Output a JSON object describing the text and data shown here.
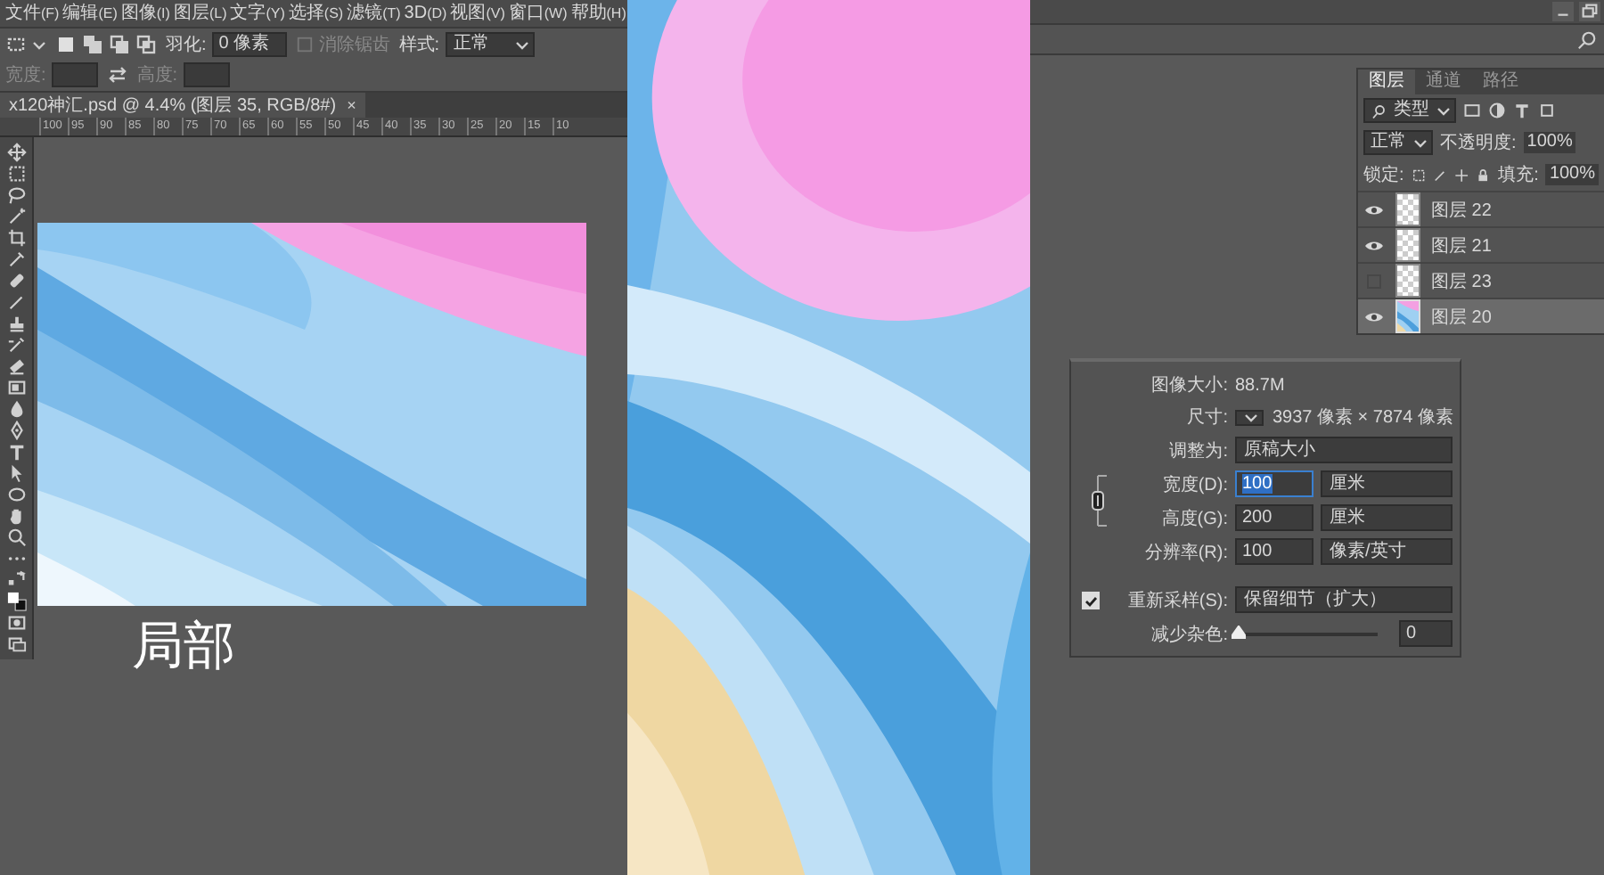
{
  "left_window": {
    "menu": [
      {
        "label": "文件",
        "key": "(F)"
      },
      {
        "label": "编辑",
        "key": "(E)"
      },
      {
        "label": "图像",
        "key": "(I)"
      },
      {
        "label": "图层",
        "key": "(L)"
      },
      {
        "label": "文字",
        "key": "(Y)"
      },
      {
        "label": "选择",
        "key": "(S)"
      },
      {
        "label": "滤镜",
        "key": "(T)"
      },
      {
        "label": "3D",
        "key": "(D)"
      },
      {
        "label": "视图",
        "key": "(V)"
      },
      {
        "label": "窗口",
        "key": "(W)"
      },
      {
        "label": "帮助",
        "key": "(H)"
      }
    ],
    "options_bar": {
      "feather_label": "羽化:",
      "feather_value": "0 像素",
      "anti_alias": "消除锯齿",
      "style_label": "样式:",
      "style_value": "正常",
      "width_label": "宽度:",
      "height_label": "高度:"
    },
    "document_tab": {
      "title": "x120神汇.psd @ 4.4% (图层 35, RGB/8#)",
      "close": "×"
    },
    "ruler": [
      "100",
      "95",
      "90",
      "85",
      "80",
      "75",
      "70",
      "65",
      "60",
      "55",
      "50",
      "45",
      "40",
      "35",
      "30",
      "25",
      "20",
      "15",
      "10"
    ],
    "caption": "局部"
  },
  "right_window": {
    "layers_panel": {
      "tabs": [
        {
          "label": "图层",
          "selected": true
        },
        {
          "label": "通道",
          "selected": false
        },
        {
          "label": "路径",
          "selected": false
        }
      ],
      "filter": "类型",
      "blend_mode": "正常",
      "opacity_label": "不透明度:",
      "opacity": "100%",
      "lock_label": "锁定:",
      "fill_label": "填充:",
      "fill": "100%",
      "layers": [
        {
          "name": "图层 22",
          "visible": true,
          "selected": false,
          "kind": "transparent"
        },
        {
          "name": "图层 21",
          "visible": true,
          "selected": false,
          "kind": "transparent"
        },
        {
          "name": "图层 23",
          "visible": false,
          "selected": false,
          "kind": "transparent"
        },
        {
          "name": "图层 20",
          "visible": true,
          "selected": true,
          "kind": "picture"
        }
      ]
    },
    "image_size_dialog": {
      "image_size_label": "图像大小:",
      "image_size": "88.7M",
      "dimensions_label": "尺寸:",
      "dimensions": "3937 像素 × 7874 像素",
      "fit_to_label": "调整为:",
      "fit_to": "原稿大小",
      "fields": [
        {
          "label": "宽度(D):",
          "value": "100",
          "unit": "厘米",
          "focused": true
        },
        {
          "label": "高度(G):",
          "value": "200",
          "unit": "厘米",
          "focused": false
        },
        {
          "label": "分辨率(R):",
          "value": "100",
          "unit": "像素/英寸",
          "focused": false
        }
      ],
      "resample": {
        "label": "重新采样(S):",
        "checked": true,
        "value": "保留细节（扩大）"
      },
      "noise": {
        "label": "减少杂色:",
        "level": 0,
        "value": "0"
      }
    }
  }
}
